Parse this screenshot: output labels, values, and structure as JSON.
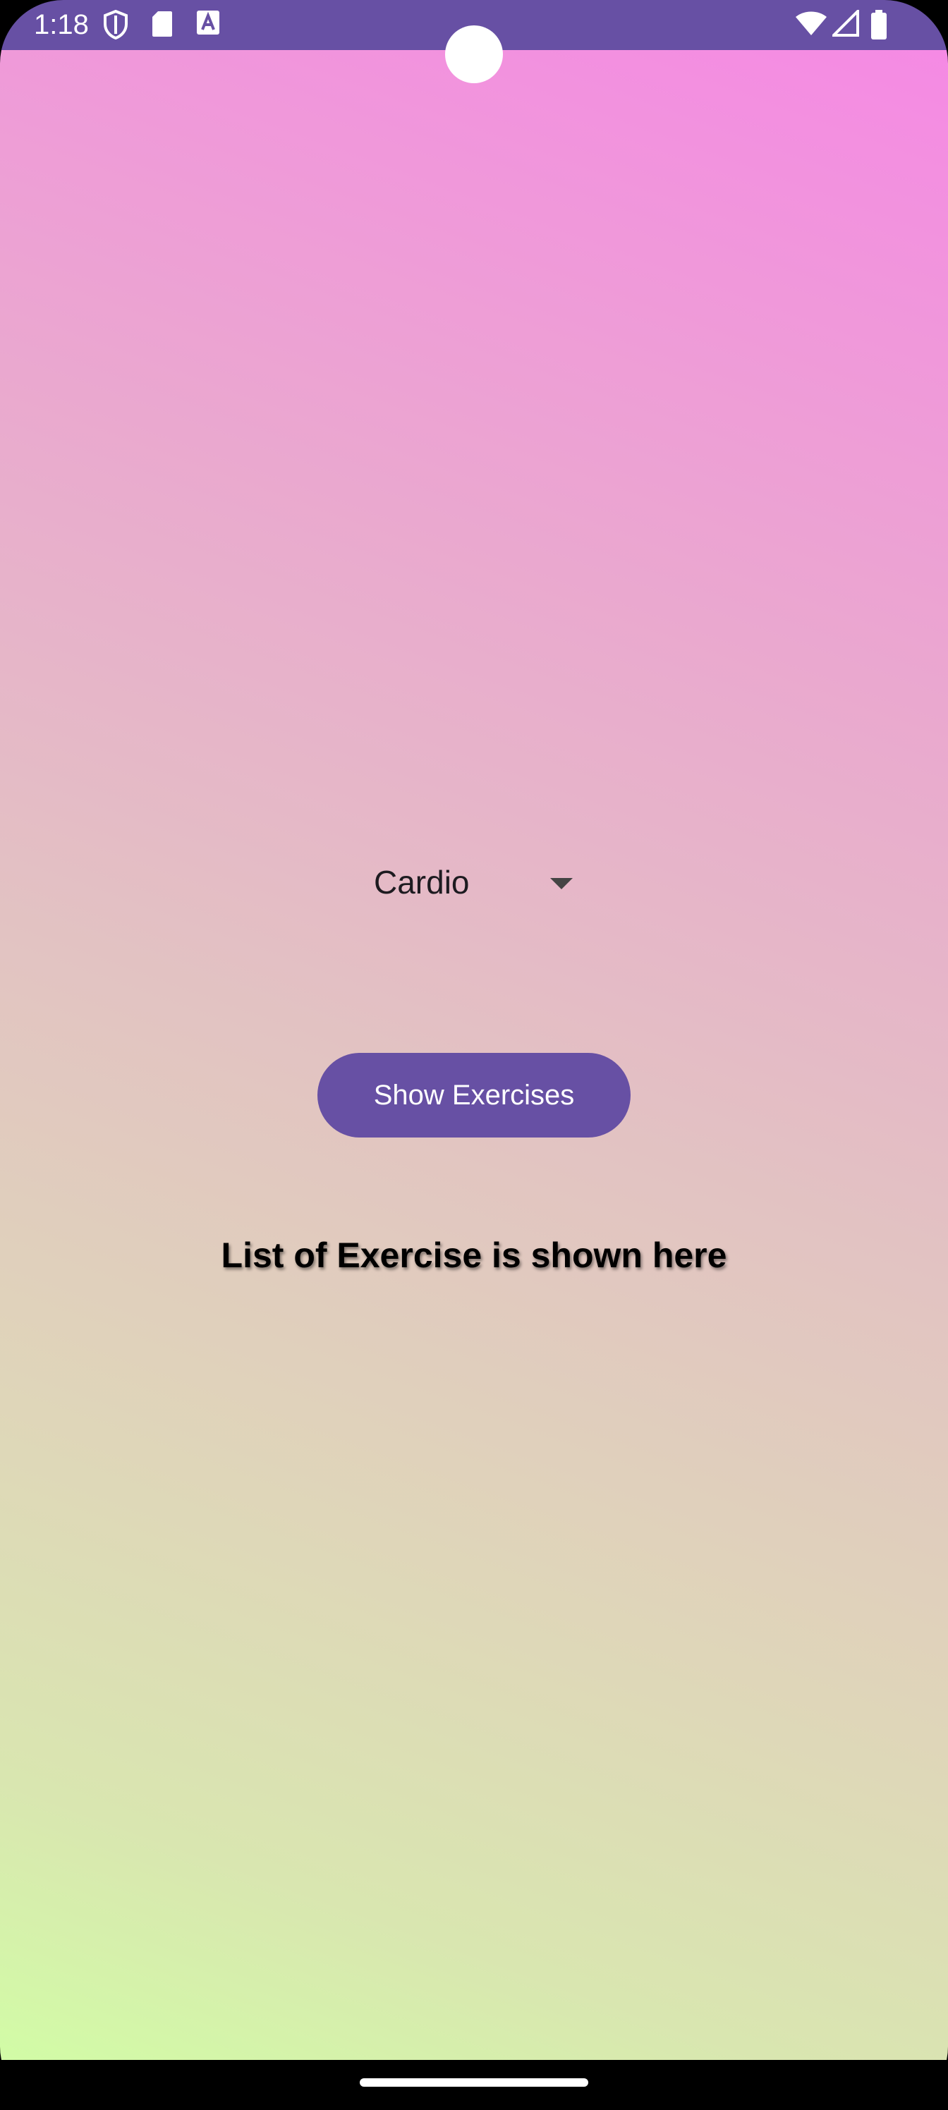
{
  "status_bar": {
    "time": "1:18",
    "background_color": "#6750a4",
    "left_icons": [
      "shield-icon",
      "sd-card-icon",
      "a-badge-icon"
    ],
    "right_icons": [
      "wifi-icon",
      "signal-icon",
      "battery-icon"
    ]
  },
  "spinner": {
    "selected_value": "Cardio",
    "arrow_icon": "dropdown-arrow-icon"
  },
  "show_button": {
    "label": "Show Exercises",
    "color": "#6750a4"
  },
  "result": {
    "text": "List of Exercise is shown here"
  },
  "background_gradient": {
    "top_color": "#f58ae4",
    "bottom_color": "#d3fca8"
  }
}
